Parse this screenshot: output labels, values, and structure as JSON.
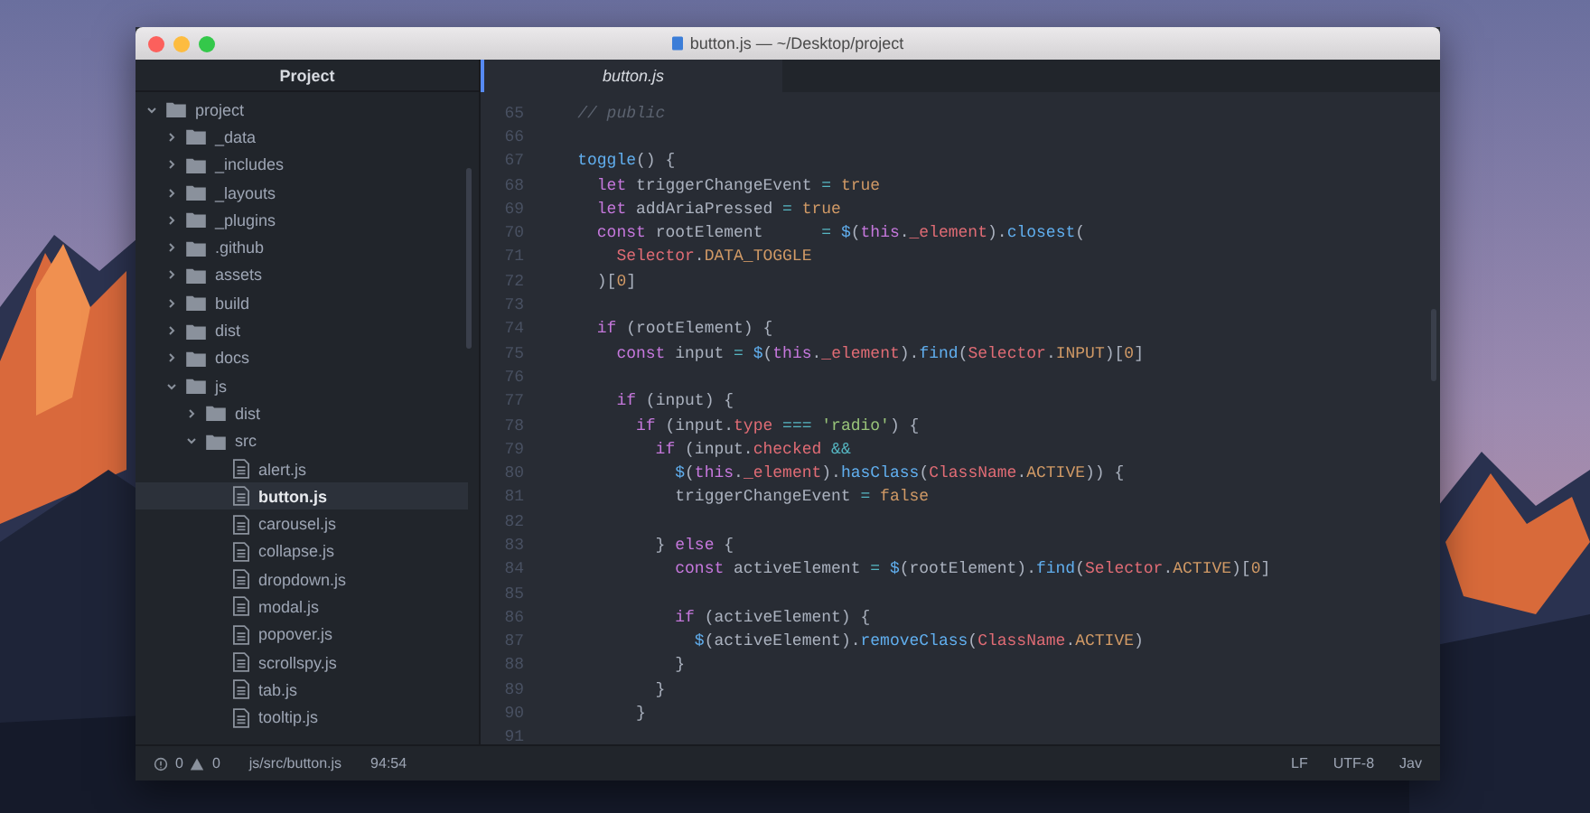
{
  "window": {
    "title": "button.js — ~/Desktop/project"
  },
  "sidebar": {
    "title": "Project",
    "tree": [
      {
        "name": "project",
        "kind": "folder",
        "expanded": true,
        "selected": false,
        "children": [
          {
            "name": "_data",
            "kind": "folder",
            "expanded": false,
            "selected": false
          },
          {
            "name": "_includes",
            "kind": "folder",
            "expanded": false,
            "selected": false
          },
          {
            "name": "_layouts",
            "kind": "folder",
            "expanded": false,
            "selected": false
          },
          {
            "name": "_plugins",
            "kind": "folder",
            "expanded": false,
            "selected": false
          },
          {
            "name": ".github",
            "kind": "folder",
            "expanded": false,
            "selected": false
          },
          {
            "name": "assets",
            "kind": "folder",
            "expanded": false,
            "selected": false
          },
          {
            "name": "build",
            "kind": "folder",
            "expanded": false,
            "selected": false
          },
          {
            "name": "dist",
            "kind": "folder",
            "expanded": false,
            "selected": false
          },
          {
            "name": "docs",
            "kind": "folder",
            "expanded": false,
            "selected": false
          },
          {
            "name": "js",
            "kind": "folder",
            "expanded": true,
            "selected": false,
            "children": [
              {
                "name": "dist",
                "kind": "folder",
                "expanded": false,
                "selected": false
              },
              {
                "name": "src",
                "kind": "folder",
                "expanded": true,
                "selected": false,
                "children": [
                  {
                    "name": "alert.js",
                    "kind": "file",
                    "selected": false
                  },
                  {
                    "name": "button.js",
                    "kind": "file",
                    "selected": true
                  },
                  {
                    "name": "carousel.js",
                    "kind": "file",
                    "selected": false
                  },
                  {
                    "name": "collapse.js",
                    "kind": "file",
                    "selected": false
                  },
                  {
                    "name": "dropdown.js",
                    "kind": "file",
                    "selected": false
                  },
                  {
                    "name": "modal.js",
                    "kind": "file",
                    "selected": false
                  },
                  {
                    "name": "popover.js",
                    "kind": "file",
                    "selected": false
                  },
                  {
                    "name": "scrollspy.js",
                    "kind": "file",
                    "selected": false
                  },
                  {
                    "name": "tab.js",
                    "kind": "file",
                    "selected": false
                  },
                  {
                    "name": "tooltip.js",
                    "kind": "file",
                    "selected": false
                  }
                ]
              }
            ]
          }
        ]
      }
    ]
  },
  "tabs": [
    {
      "label": "button.js",
      "selected": true
    }
  ],
  "editor": {
    "lines": [
      {
        "number": "65",
        "tokens": [
          {
            "kind": "comment",
            "text": "    // public"
          }
        ]
      },
      {
        "number": "66"
      },
      {
        "number": "67",
        "tokens": [
          {
            "kind": "fn",
            "text": "    toggle"
          },
          {
            "kind": "plain",
            "text": "() {"
          }
        ]
      },
      {
        "number": "68",
        "tokens": [
          {
            "kind": "kw",
            "text": "      let"
          },
          {
            "kind": "plain",
            "text": " triggerChangeEvent "
          },
          {
            "kind": "op",
            "text": "="
          },
          {
            "kind": "num",
            "text": " true"
          }
        ]
      },
      {
        "number": "69",
        "tokens": [
          {
            "kind": "kw",
            "text": "      let"
          },
          {
            "kind": "plain",
            "text": " addAriaPressed "
          },
          {
            "kind": "op",
            "text": "="
          },
          {
            "kind": "num",
            "text": " true"
          }
        ]
      },
      {
        "number": "70",
        "tokens": [
          {
            "kind": "kw",
            "text": "      const"
          },
          {
            "kind": "plain",
            "text": " rootElement      "
          },
          {
            "kind": "op",
            "text": "="
          },
          {
            "kind": "fn",
            "text": " $"
          },
          {
            "kind": "plain",
            "text": "("
          },
          {
            "kind": "kw",
            "text": "this"
          },
          {
            "kind": "plain",
            "text": "."
          },
          {
            "kind": "prop",
            "text": "_element"
          },
          {
            "kind": "plain",
            "text": ")."
          },
          {
            "kind": "fn",
            "text": "closest"
          },
          {
            "kind": "plain",
            "text": "("
          }
        ]
      },
      {
        "number": "71",
        "tokens": [
          {
            "kind": "prop",
            "text": "        Selector"
          },
          {
            "kind": "plain",
            "text": "."
          },
          {
            "kind": "num",
            "text": "DATA_TOGGLE"
          }
        ]
      },
      {
        "number": "72",
        "tokens": [
          {
            "kind": "plain",
            "text": "      )["
          },
          {
            "kind": "num",
            "text": "0"
          },
          {
            "kind": "plain",
            "text": "]"
          }
        ]
      },
      {
        "number": "73"
      },
      {
        "number": "74",
        "tokens": [
          {
            "kind": "kw",
            "text": "      if"
          },
          {
            "kind": "plain",
            "text": " (rootElement) {"
          }
        ]
      },
      {
        "number": "75",
        "tokens": [
          {
            "kind": "kw",
            "text": "        const"
          },
          {
            "kind": "plain",
            "text": " input "
          },
          {
            "kind": "op",
            "text": "="
          },
          {
            "kind": "fn",
            "text": " $"
          },
          {
            "kind": "plain",
            "text": "("
          },
          {
            "kind": "kw",
            "text": "this"
          },
          {
            "kind": "plain",
            "text": "."
          },
          {
            "kind": "prop",
            "text": "_element"
          },
          {
            "kind": "plain",
            "text": ")."
          },
          {
            "kind": "fn",
            "text": "find"
          },
          {
            "kind": "plain",
            "text": "("
          },
          {
            "kind": "prop",
            "text": "Selector"
          },
          {
            "kind": "plain",
            "text": "."
          },
          {
            "kind": "num",
            "text": "INPUT"
          },
          {
            "kind": "plain",
            "text": ")["
          },
          {
            "kind": "num",
            "text": "0"
          },
          {
            "kind": "plain",
            "text": "]"
          }
        ]
      },
      {
        "number": "76"
      },
      {
        "number": "77",
        "tokens": [
          {
            "kind": "kw",
            "text": "        if"
          },
          {
            "kind": "plain",
            "text": " (input) {"
          }
        ]
      },
      {
        "number": "78",
        "tokens": [
          {
            "kind": "kw",
            "text": "          if"
          },
          {
            "kind": "plain",
            "text": " (input."
          },
          {
            "kind": "prop",
            "text": "type"
          },
          {
            "kind": "op",
            "text": " ==="
          },
          {
            "kind": "str",
            "text": " 'radio'"
          },
          {
            "kind": "plain",
            "text": ") {"
          }
        ]
      },
      {
        "number": "79",
        "tokens": [
          {
            "kind": "kw",
            "text": "            if"
          },
          {
            "kind": "plain",
            "text": " (input."
          },
          {
            "kind": "prop",
            "text": "checked"
          },
          {
            "kind": "op",
            "text": " &&"
          }
        ]
      },
      {
        "number": "80",
        "tokens": [
          {
            "kind": "fn",
            "text": "              $"
          },
          {
            "kind": "plain",
            "text": "("
          },
          {
            "kind": "kw",
            "text": "this"
          },
          {
            "kind": "plain",
            "text": "."
          },
          {
            "kind": "prop",
            "text": "_element"
          },
          {
            "kind": "plain",
            "text": ")."
          },
          {
            "kind": "fn",
            "text": "hasClass"
          },
          {
            "kind": "plain",
            "text": "("
          },
          {
            "kind": "prop",
            "text": "ClassName"
          },
          {
            "kind": "plain",
            "text": "."
          },
          {
            "kind": "num",
            "text": "ACTIVE"
          },
          {
            "kind": "plain",
            "text": ")) {"
          }
        ]
      },
      {
        "number": "81",
        "tokens": [
          {
            "kind": "plain",
            "text": "              triggerChangeEvent "
          },
          {
            "kind": "op",
            "text": "="
          },
          {
            "kind": "num",
            "text": " false"
          }
        ]
      },
      {
        "number": "82"
      },
      {
        "number": "83",
        "tokens": [
          {
            "kind": "plain",
            "text": "            } "
          },
          {
            "kind": "kw",
            "text": "else"
          },
          {
            "kind": "plain",
            "text": " {"
          }
        ]
      },
      {
        "number": "84",
        "tokens": [
          {
            "kind": "kw",
            "text": "              const"
          },
          {
            "kind": "plain",
            "text": " activeElement "
          },
          {
            "kind": "op",
            "text": "="
          },
          {
            "kind": "fn",
            "text": " $"
          },
          {
            "kind": "plain",
            "text": "(rootElement)."
          },
          {
            "kind": "fn",
            "text": "find"
          },
          {
            "kind": "plain",
            "text": "("
          },
          {
            "kind": "prop",
            "text": "Selector"
          },
          {
            "kind": "plain",
            "text": "."
          },
          {
            "kind": "num",
            "text": "ACTIVE"
          },
          {
            "kind": "plain",
            "text": ")["
          },
          {
            "kind": "num",
            "text": "0"
          },
          {
            "kind": "plain",
            "text": "]"
          }
        ]
      },
      {
        "number": "85"
      },
      {
        "number": "86",
        "tokens": [
          {
            "kind": "kw",
            "text": "              if"
          },
          {
            "kind": "plain",
            "text": " (activeElement) {"
          }
        ]
      },
      {
        "number": "87",
        "tokens": [
          {
            "kind": "fn",
            "text": "                $"
          },
          {
            "kind": "plain",
            "text": "(activeElement)."
          },
          {
            "kind": "fn",
            "text": "removeClass"
          },
          {
            "kind": "plain",
            "text": "("
          },
          {
            "kind": "prop",
            "text": "ClassName"
          },
          {
            "kind": "plain",
            "text": "."
          },
          {
            "kind": "num",
            "text": "ACTIVE"
          },
          {
            "kind": "plain",
            "text": ")"
          }
        ]
      },
      {
        "number": "88",
        "tokens": [
          {
            "kind": "plain",
            "text": "              }"
          }
        ]
      },
      {
        "number": "89",
        "tokens": [
          {
            "kind": "plain",
            "text": "            }"
          }
        ]
      },
      {
        "number": "90",
        "tokens": [
          {
            "kind": "plain",
            "text": "          }"
          }
        ]
      },
      {
        "number": "91"
      }
    ]
  },
  "status_bar": {
    "errors": "0",
    "warnings": "0",
    "path": "js/src/button.js",
    "cursor": "94:54",
    "right": [
      "LF",
      "UTF-8",
      "Jav"
    ]
  }
}
